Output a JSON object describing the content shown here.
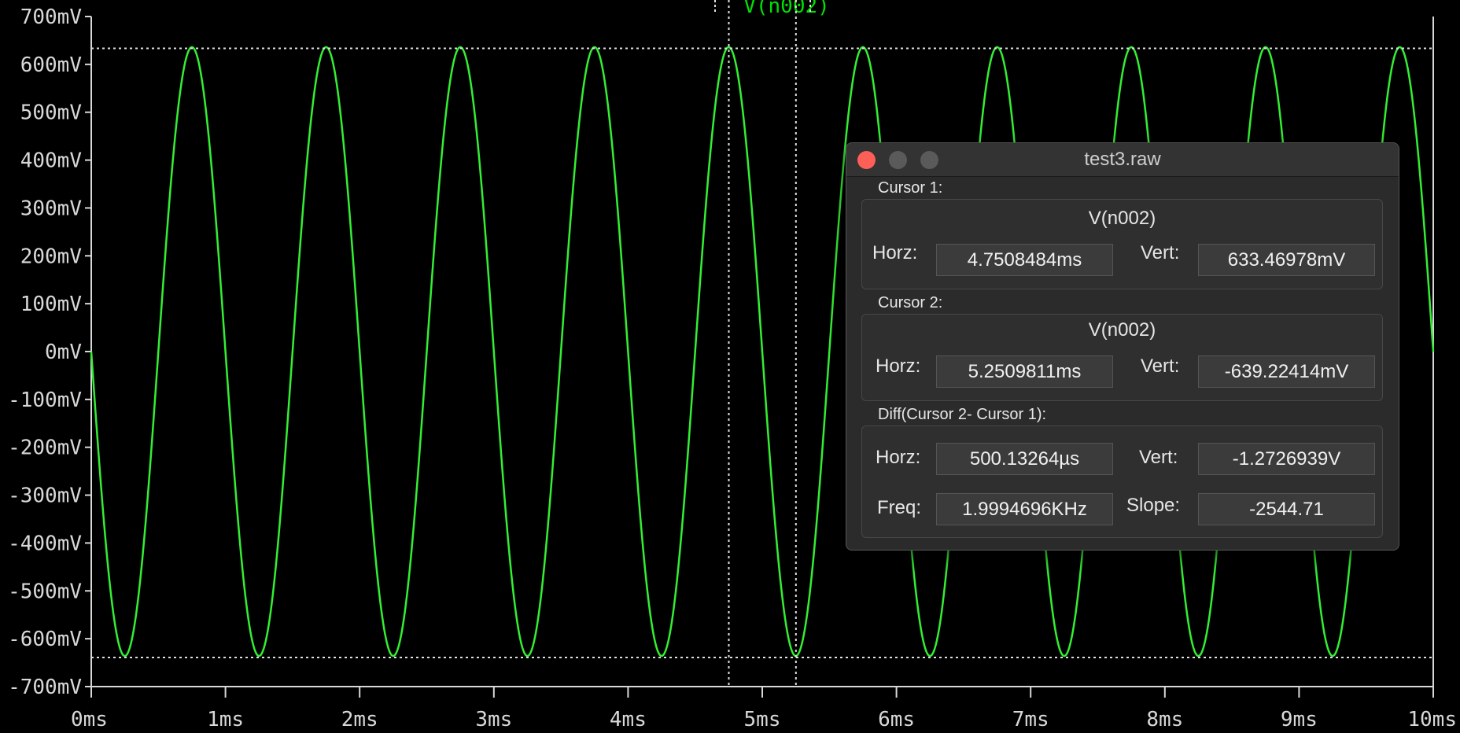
{
  "trace": {
    "name": "V(n002)",
    "color": "#33ee33"
  },
  "chart_data": {
    "type": "line",
    "x_unit": "ms",
    "y_unit": "mV",
    "xlim": [
      0,
      10
    ],
    "ylim": [
      -700,
      700
    ],
    "x_ticks": [
      "0ms",
      "1ms",
      "2ms",
      "3ms",
      "4ms",
      "5ms",
      "6ms",
      "7ms",
      "8ms",
      "9ms",
      "10ms"
    ],
    "y_ticks": [
      "700mV",
      "600mV",
      "500mV",
      "400mV",
      "300mV",
      "200mV",
      "100mV",
      "0mV",
      "-100mV",
      "-200mV",
      "-300mV",
      "-400mV",
      "-500mV",
      "-600mV",
      "-700mV"
    ],
    "series": [
      {
        "name": "V(n002)",
        "function": "sine",
        "amplitude_mV": 636,
        "frequency_kHz": 1,
        "phase": "negative-going at 0ms"
      }
    ],
    "cursors": [
      {
        "x_ms": 4.7508484,
        "y_mV": 633.46978
      },
      {
        "x_ms": 5.2509811,
        "y_mV": -639.22414
      }
    ]
  },
  "window": {
    "title": "test3.raw",
    "cursor1": {
      "label": "Cursor 1:",
      "trace": "V(n002)",
      "horz_label": "Horz:",
      "horz": "4.7508484ms",
      "vert_label": "Vert:",
      "vert": "633.46978mV"
    },
    "cursor2": {
      "label": "Cursor 2:",
      "trace": "V(n002)",
      "horz_label": "Horz:",
      "horz": "5.2509811ms",
      "vert_label": "Vert:",
      "vert": "-639.22414mV"
    },
    "diff": {
      "label": "Diff(Cursor 2- Cursor 1):",
      "horz_label": "Horz:",
      "horz": "500.13264µs",
      "vert_label": "Vert:",
      "vert": "-1.2726939V",
      "freq_label": "Freq:",
      "freq": "1.9994696KHz",
      "slope_label": "Slope:",
      "slope": "-2544.71"
    }
  }
}
